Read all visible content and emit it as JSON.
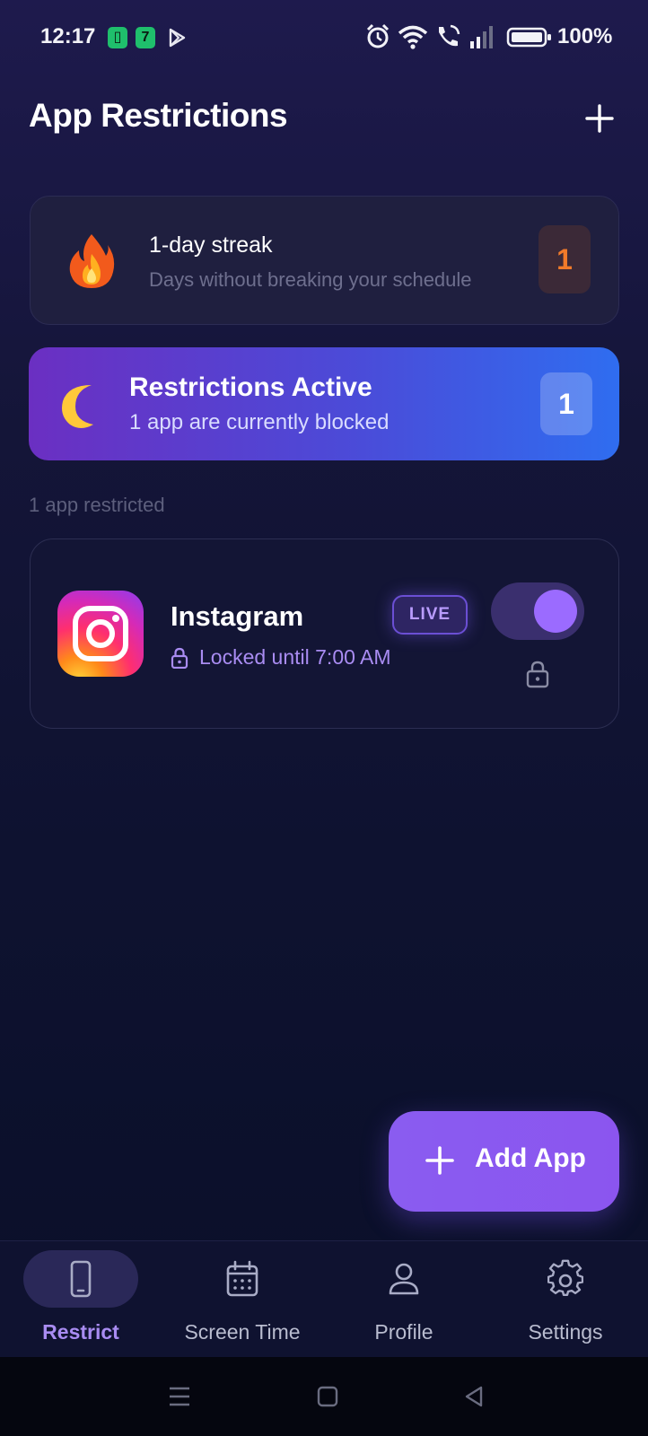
{
  "status_bar": {
    "time": "12:17",
    "notif_1": "▯",
    "notif_2": "7",
    "battery": "100%"
  },
  "header": {
    "title": "App Restrictions",
    "add_icon": "plus-icon"
  },
  "streak": {
    "emoji_icon": "fire-icon",
    "title": "1-day streak",
    "subtitle": "Days without breaking your schedule",
    "count": "1"
  },
  "active": {
    "emoji_icon": "moon-icon",
    "title": "Restrictions Active",
    "subtitle": "1 app are currently blocked",
    "count": "1"
  },
  "section_label": "1 app restricted",
  "apps": [
    {
      "name": "Instagram",
      "status": "Locked until 7:00 AM",
      "badge": "LIVE",
      "enabled": true,
      "icon": "instagram-icon"
    }
  ],
  "fab": {
    "label": "Add App",
    "icon": "plus-icon"
  },
  "bottom_nav": {
    "items": [
      {
        "label": "Restrict",
        "icon": "phone-icon",
        "active": true
      },
      {
        "label": "Screen Time",
        "icon": "calendar-icon",
        "active": false
      },
      {
        "label": "Profile",
        "icon": "person-icon",
        "active": false
      },
      {
        "label": "Settings",
        "icon": "gear-icon",
        "active": false
      }
    ]
  },
  "colors": {
    "accent": "#8b5cf6",
    "streak_number": "#f07a2a",
    "background": "#12143a"
  }
}
